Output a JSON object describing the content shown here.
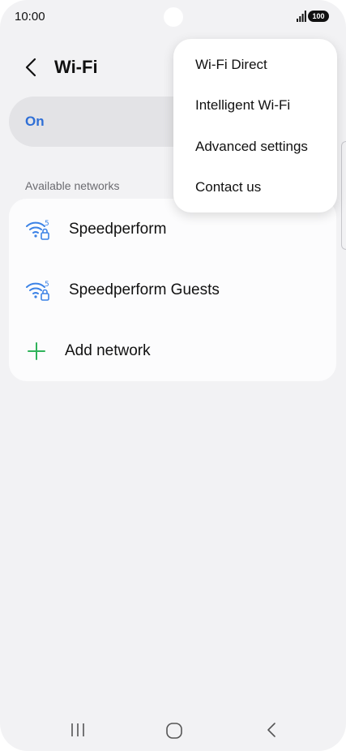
{
  "status_bar": {
    "time": "10:00",
    "battery": "100"
  },
  "header": {
    "title": "Wi-Fi"
  },
  "wifi_toggle": {
    "label": "On",
    "enabled": true
  },
  "networks": {
    "section_label": "Available networks",
    "items": [
      {
        "name": "Speedperform",
        "icon": "wifi-5ghz-locked-icon"
      },
      {
        "name": "Speedperform Guests",
        "icon": "wifi-5ghz-locked-icon"
      }
    ],
    "add_label": "Add network"
  },
  "overflow_menu": {
    "items": [
      {
        "label": "Wi-Fi Direct"
      },
      {
        "label": "Intelligent Wi-Fi"
      },
      {
        "label": "Advanced settings"
      },
      {
        "label": "Contact us"
      }
    ]
  },
  "colors": {
    "accent": "#2f6fd6",
    "wifi_icon": "#3b82e6",
    "add_icon": "#2fb35a",
    "background": "#f2f2f4"
  },
  "nav_bar": {
    "icons": [
      "recent-apps-icon",
      "home-icon",
      "back-icon"
    ]
  }
}
